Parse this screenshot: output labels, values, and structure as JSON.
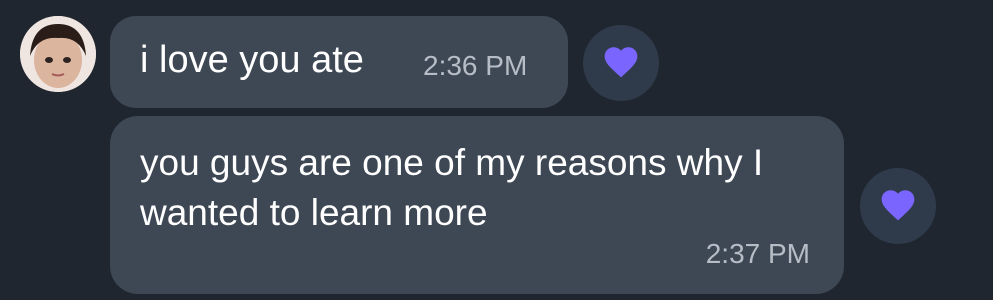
{
  "messages": [
    {
      "text": "i love you ate",
      "time": "2:36 PM",
      "reaction": "heart-icon"
    },
    {
      "text": "you guys are one of my reasons why I wanted to learn more",
      "time": "2:37 PM",
      "reaction": "heart-icon"
    }
  ],
  "colors": {
    "background": "#1f2630",
    "bubble": "#3e4855",
    "reaction_bg": "#2f3b4a",
    "heart": "#7a66ff",
    "timestamp": "#b7bdc6"
  }
}
